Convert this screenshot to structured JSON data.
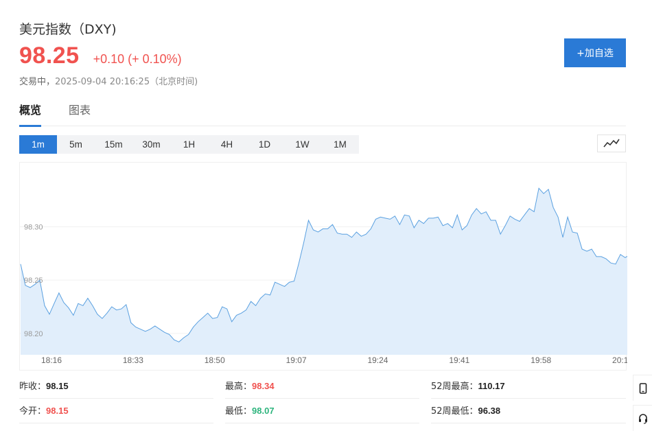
{
  "header": {
    "title": "美元指数（DXY)",
    "price": "98.25",
    "change": "+0.10 (+ 0.10%)",
    "status": "交易中，",
    "timestamp": "2025-09-04 20:16:25（北京时间)",
    "add_button": "+加自选"
  },
  "tabs": [
    {
      "label": "概览",
      "active": true
    },
    {
      "label": "图表",
      "active": false
    }
  ],
  "intervals": [
    {
      "label": "1m",
      "active": true
    },
    {
      "label": "5m"
    },
    {
      "label": "15m"
    },
    {
      "label": "30m"
    },
    {
      "label": "1H"
    },
    {
      "label": "4H"
    },
    {
      "label": "1D"
    },
    {
      "label": "1W"
    },
    {
      "label": "1M"
    }
  ],
  "chart_type_icon": "line-chart-icon",
  "colors": {
    "accent": "#2a7ad6",
    "up": "#f0524f",
    "down": "#2db47d",
    "line": "#5aa0e0",
    "area": "#e1eefb"
  },
  "chart_data": {
    "type": "area",
    "ylim": [
      98.18,
      98.36
    ],
    "y_ticks": [
      "98.30",
      "98.25",
      "98.20"
    ],
    "y_tick_values": [
      98.3,
      98.25,
      98.2
    ],
    "x_ticks": [
      "18:16",
      "18:33",
      "18:50",
      "19:07",
      "19:24",
      "19:41",
      "19:58",
      "20:1"
    ],
    "x_tick_values": [
      0,
      17,
      34,
      51,
      68,
      85,
      102,
      119
    ],
    "x_max": 126,
    "values": [
      98.265,
      98.245,
      98.243,
      98.246,
      98.25,
      98.226,
      98.218,
      98.228,
      98.238,
      98.229,
      98.224,
      98.217,
      98.228,
      98.226,
      98.233,
      98.226,
      98.218,
      98.214,
      98.219,
      98.225,
      98.222,
      98.223,
      98.227,
      98.21,
      98.206,
      98.204,
      98.202,
      98.204,
      98.207,
      98.204,
      98.201,
      98.199,
      98.194,
      98.192,
      98.196,
      98.199,
      98.206,
      98.211,
      98.215,
      98.219,
      98.214,
      98.215,
      98.225,
      98.223,
      98.211,
      98.217,
      98.219,
      98.222,
      98.23,
      98.226,
      98.233,
      98.237,
      98.236,
      98.248,
      98.246,
      98.244,
      98.248,
      98.249,
      98.266,
      98.285,
      98.306,
      98.297,
      98.295,
      98.298,
      98.298,
      98.302,
      98.294,
      98.293,
      98.293,
      98.29,
      98.295,
      98.291,
      98.293,
      98.298,
      98.307,
      98.309,
      98.308,
      98.307,
      98.31,
      98.302,
      98.311,
      98.31,
      98.299,
      98.306,
      98.303,
      98.308,
      98.308,
      98.309,
      98.301,
      98.303,
      98.299,
      98.311,
      98.297,
      98.301,
      98.311,
      98.317,
      98.312,
      98.314,
      98.306,
      98.306,
      98.293,
      98.301,
      98.31,
      98.307,
      98.305,
      98.311,
      98.317,
      98.314,
      98.336,
      98.331,
      98.335,
      98.318,
      98.309,
      98.29,
      98.309,
      98.295,
      98.294,
      98.279,
      98.277,
      98.279,
      98.272,
      98.272,
      98.27,
      98.266,
      98.265,
      98.274,
      98.271,
      98.274,
      98.261
    ]
  },
  "stats": {
    "prev_close_label": "昨收：",
    "prev_close": "98.15",
    "high_label": "最高：",
    "high": "98.34",
    "w52_high_label": "52周最高：",
    "w52_high": "110.17",
    "open_label": "今开：",
    "open": "98.15",
    "low_label": "最低：",
    "low": "98.07",
    "w52_low_label": "52周最低：",
    "w52_low": "96.38"
  },
  "side_tools": [
    "mobile-icon",
    "headset-icon"
  ]
}
